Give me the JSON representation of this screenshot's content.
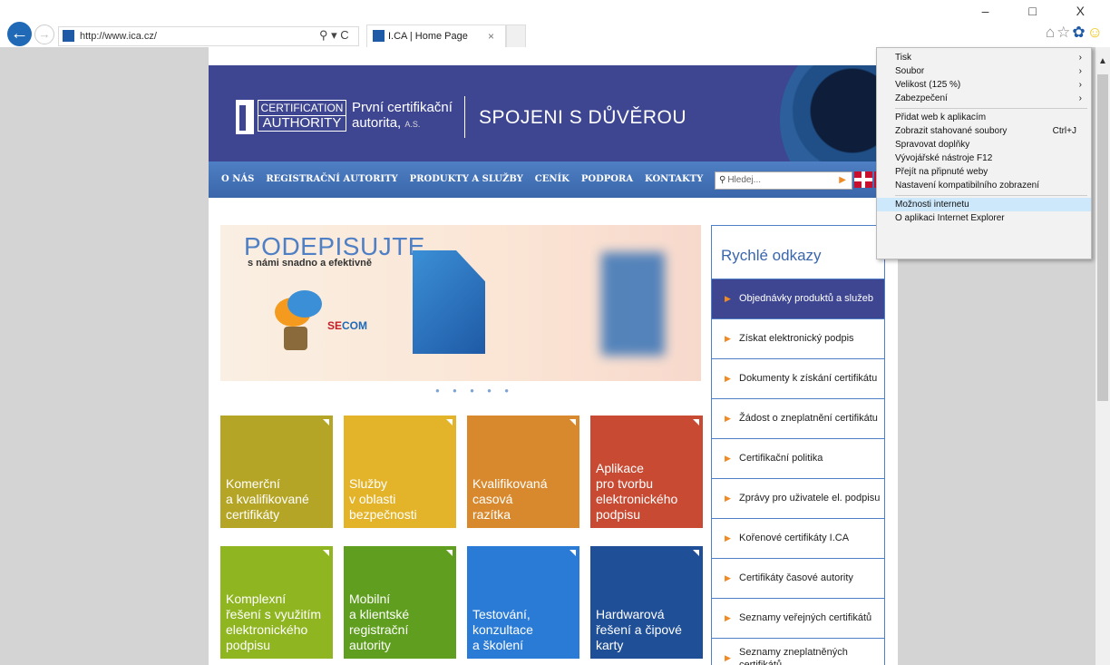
{
  "browser": {
    "url": "http://www.ica.cz/",
    "tab_title": "I.CA | Home Page",
    "tab_close": "×",
    "window_controls": "–  □  X",
    "addr_icons": "⚲ ▾ C"
  },
  "site": {
    "logo_line1": "CERTIFICATION",
    "logo_line2": "AUTHORITY",
    "header_line1": "První certifikační",
    "header_line2": "autorita, ",
    "header_as": "A.S.",
    "slogan": "SPOJENI S DŮVĚROU",
    "nav": [
      "O NÁS",
      "REGISTRAČNÍ AUTORITY",
      "PRODUKTY A SLUŽBY",
      "CENÍK",
      "PODPORA",
      "KONTAKTY"
    ],
    "search_placeholder": "Hledej...",
    "banner_title": "PODEPISUJTE",
    "banner_sub": "s námi snadno a efektivně",
    "banner_secom_a": "SE",
    "banner_secom_b": "COM",
    "tiles": [
      {
        "text": "Komerční\na kvalifikované\ncertifikáty",
        "color": "#b5a526"
      },
      {
        "text": "Služby\nv oblasti\nbezpečnosti",
        "color": "#e3b42a"
      },
      {
        "text": "Kvalifikovaná\ncasová\nrazítka",
        "color": "#d8892e"
      },
      {
        "text": "Aplikace\npro tvorbu\nelektronického\npodpisu",
        "color": "#c94a33"
      },
      {
        "text": "Komplexní\nřešení s využitím\nelektronického\npodpisu",
        "color": "#8fb520"
      },
      {
        "text": "Mobilní\na klientské\nregistrační\nautority",
        "color": "#5f9e1f"
      },
      {
        "text": "Testování,\nkonzultace\na školení",
        "color": "#2a7bd6"
      },
      {
        "text": "Hardwarová\nřešení a čipové\nkarty",
        "color": "#1f4f96"
      }
    ],
    "quick_links_title": "Rychlé odkazy",
    "quick_links": [
      "Objednávky produktů a služeb",
      "Získat elektronický podpis",
      "Dokumenty k získání certifikátu",
      "Žádost o zneplatnění certifikátu",
      "Certifikační politika",
      "Zprávy pro uživatele el. podpisu",
      "Kořenové certifikáty I.CA",
      "Certifikáty časové autority",
      "Seznamy veřejných certifikátů",
      "Seznamy zneplatněných certifikátů"
    ]
  },
  "menu": {
    "group1": [
      {
        "label": "Tisk",
        "sub": "›"
      },
      {
        "label": "Soubor",
        "sub": "›"
      },
      {
        "label": "Velikost (125 %)",
        "sub": "›"
      },
      {
        "label": "Zabezpečení",
        "sub": "›"
      }
    ],
    "group2": [
      {
        "label": "Přidat web k aplikacím"
      },
      {
        "label": "Zobrazit stahované soubory",
        "shortcut": "Ctrl+J"
      },
      {
        "label": "Spravovat doplňky"
      },
      {
        "label": "Vývojářské nástroje F12"
      },
      {
        "label": "Přejít na připnuté weby"
      },
      {
        "label": "Nastavení kompatibilního zobrazení"
      }
    ],
    "group3": [
      {
        "label": "Možnosti internetu"
      },
      {
        "label": "O aplikaci Internet Explorer"
      }
    ]
  }
}
